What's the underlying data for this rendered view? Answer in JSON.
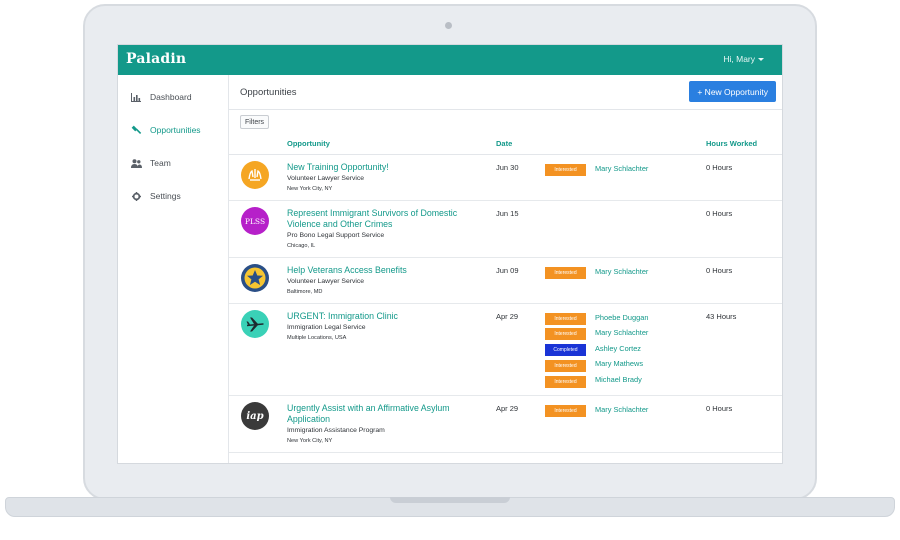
{
  "app": {
    "brand": "Paladin",
    "greeting": "Hi, Mary"
  },
  "sidebar": {
    "items": [
      {
        "label": "Dashboard",
        "icon": "bar-chart-icon",
        "active": false
      },
      {
        "label": "Opportunities",
        "icon": "gavel-icon",
        "active": true
      },
      {
        "label": "Team",
        "icon": "team-icon",
        "active": false
      },
      {
        "label": "Settings",
        "icon": "gear-icon",
        "active": false
      }
    ]
  },
  "main": {
    "title": "Opportunities",
    "new_button": "+ New Opportunity",
    "filters_label": "Filters",
    "columns": {
      "opportunity": "Opportunity",
      "date": "Date",
      "hours": "Hours Worked"
    }
  },
  "rows": [
    {
      "title": "New Training Opportunity!",
      "org": "Volunteer Lawyer Service",
      "location": "New York City, NY",
      "date": "Jun 30",
      "hours": "0 Hours",
      "logo": {
        "text": "",
        "color": "#f5a623"
      },
      "assignees": [
        {
          "status": "Interested",
          "name": "Mary Schlachter"
        }
      ]
    },
    {
      "title": "Represent Immigrant Survivors of Domestic Violence and Other Crimes",
      "org": "Pro Bono Legal Support Service",
      "location": "Chicago, IL",
      "date": "Jun 15",
      "hours": "0 Hours",
      "logo": {
        "text": "PLSS",
        "color": "#b620c9"
      },
      "assignees": []
    },
    {
      "title": "Help Veterans Access Benefits",
      "org": "Volunteer Lawyer Service",
      "location": "Baltimore, MD",
      "date": "Jun 09",
      "hours": "0 Hours",
      "logo": {
        "text": "",
        "color": "#2a4f86"
      },
      "assignees": [
        {
          "status": "Interested",
          "name": "Mary Schlachter"
        }
      ]
    },
    {
      "title": "URGENT: Immigration Clinic",
      "org": "Immigration Legal Service",
      "location": "Multiple Locations, USA",
      "date": "Apr 29",
      "hours": "43 Hours",
      "logo": {
        "text": "",
        "color": "#3ad1b7"
      },
      "assignees": [
        {
          "status": "Interested",
          "name": "Phoebe Duggan"
        },
        {
          "status": "Interested",
          "name": "Mary Schlachter"
        },
        {
          "status": "Completed",
          "name": "Ashley Cortez"
        },
        {
          "status": "Interested",
          "name": "Mary Mathews"
        },
        {
          "status": "Interested",
          "name": "Michael Brady"
        }
      ]
    },
    {
      "title": "Urgently Assist with an Affirmative Asylum Application",
      "org": "Immigration Assistance Program",
      "location": "New York City, NY",
      "date": "Apr 29",
      "hours": "0 Hours",
      "logo": {
        "text": "iap",
        "color": "#3a3a3a"
      },
      "assignees": [
        {
          "status": "Interested",
          "name": "Mary Schlachter"
        }
      ]
    }
  ],
  "colors": {
    "brand": "#13998a",
    "button": "#2a7fe0",
    "interested": "#f39222",
    "completed": "#1a34d6"
  }
}
